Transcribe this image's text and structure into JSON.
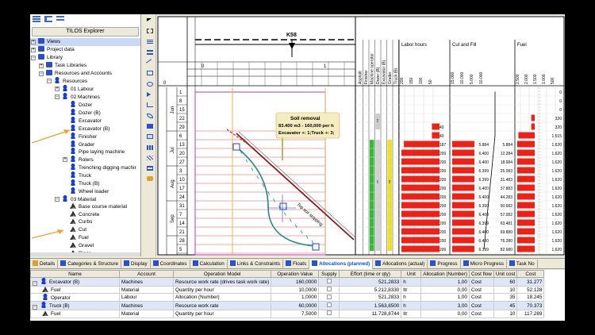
{
  "explorer": {
    "title": "TILOS Explorer",
    "items": [
      {
        "label": "Views",
        "icon": "folder-icon",
        "level": 0,
        "expander": "plus",
        "selected": true
      },
      {
        "label": "Project data",
        "icon": "folder-icon",
        "level": 0,
        "expander": "plus"
      },
      {
        "label": "Library",
        "icon": "folder-icon",
        "level": 0,
        "expander": "minus"
      },
      {
        "label": "Task Libraries",
        "icon": "folder-icon",
        "level": 1,
        "expander": "plus"
      },
      {
        "label": "Resources and Accounts",
        "icon": "folder-icon",
        "level": 1,
        "expander": "minus"
      },
      {
        "label": "Resources",
        "icon": "resource-icon",
        "level": 2,
        "expander": "minus"
      },
      {
        "label": "01 Labour",
        "icon": "resource-icon",
        "level": 3,
        "expander": "plus"
      },
      {
        "label": "02 Machines",
        "icon": "resource-icon",
        "level": 3,
        "expander": "minus"
      },
      {
        "label": "Dozer",
        "icon": "resource-icon",
        "level": 4
      },
      {
        "label": "Dozer (B)",
        "icon": "resource-icon",
        "level": 4
      },
      {
        "label": "Excavator",
        "icon": "resource-icon",
        "level": 4
      },
      {
        "label": "Excavator (B)",
        "icon": "resource-icon",
        "level": 4
      },
      {
        "label": "Finisher",
        "icon": "resource-icon",
        "level": 4
      },
      {
        "label": "Grader",
        "icon": "resource-icon",
        "level": 4
      },
      {
        "label": "Pipe laying machine",
        "icon": "resource-icon",
        "level": 4
      },
      {
        "label": "Rolers",
        "icon": "resource-icon",
        "level": 4,
        "expander": "plus"
      },
      {
        "label": "Trenching digging machir",
        "icon": "resource-icon",
        "level": 4
      },
      {
        "label": "Truck",
        "icon": "resource-icon",
        "level": 4
      },
      {
        "label": "Truck (B)",
        "icon": "resource-icon",
        "level": 4
      },
      {
        "label": "Wheel loader",
        "icon": "resource-icon",
        "level": 4
      },
      {
        "label": "03 Material",
        "icon": "resource-icon",
        "level": 3,
        "expander": "minus"
      },
      {
        "label": "Base course material",
        "icon": "material-icon",
        "level": 4
      },
      {
        "label": "Concrete",
        "icon": "material-icon",
        "level": 4
      },
      {
        "label": "Curbs",
        "icon": "material-icon",
        "level": 4
      },
      {
        "label": "Cut",
        "icon": "material-icon",
        "level": 4
      },
      {
        "label": "Fuel",
        "icon": "material-icon",
        "level": 4
      },
      {
        "label": "Gravel",
        "icon": "material-icon",
        "level": 4
      },
      {
        "label": "Piece",
        "icon": "material-icon",
        "level": 4
      }
    ]
  },
  "tools": [
    "pointer-icon",
    "select-icon",
    "rows-icon",
    "list-icon",
    "line-icon",
    "rect-icon",
    "circle-icon",
    "arrow-icon",
    "pen-icon",
    "curve-icon",
    "text-icon",
    "frame-icon",
    "bar-icon",
    "hatch-icon",
    "table-icon",
    "brush-icon"
  ],
  "chart": {
    "station_label": "K58",
    "axis_top_value": "0",
    "station_ticks": [
      "0",
      "1"
    ],
    "callout": {
      "title": "Soil removal",
      "line1": "83.400 m3 - 160,000 per h",
      "line2": "Excavator +: 1;Truck +: 3;"
    },
    "task_label": "Top soil stripping",
    "week_labels": [
      "1",
      "8",
      "15",
      "22",
      "29",
      "6",
      "13",
      "20",
      "27",
      "3",
      "10",
      "17",
      "24",
      "31",
      "7",
      "14",
      "21",
      "28",
      "5"
    ],
    "months": [
      "Jun",
      "Jul",
      "Aug",
      "Sep"
    ],
    "vert_headers": [
      "Asphalt",
      "Finisher",
      "Machine operator",
      "Dozer (B)",
      "Excavator (B)",
      "Grader",
      "Truck (B)"
    ],
    "vert_counts": [
      "1",
      "1",
      "3"
    ],
    "section_titles": {
      "labor": "Labor hours",
      "cut": "Cut and Fill",
      "fuel": "Fuel"
    },
    "labor_ticks": [
      "200",
      "150",
      "100",
      "50"
    ],
    "cut_ticks": [
      "15.000",
      "10.000",
      "5.000",
      "10.000"
    ],
    "fuel_ticks": [
      "2.500",
      "2.000",
      "1.500",
      "1.000",
      "500"
    ],
    "labor_values": [
      "",
      "",
      "",
      "",
      "40",
      "40",
      "187",
      "200",
      "200",
      "200",
      "200",
      "200",
      "200",
      "200",
      "200",
      "200",
      "200",
      "200",
      "200"
    ],
    "labor_hours": [
      0,
      0,
      0,
      0,
      40,
      40,
      187,
      200,
      200,
      200,
      200,
      200,
      200,
      200,
      200,
      200,
      200,
      200,
      200
    ],
    "cut_vals1": [
      "",
      "",
      "",
      "",
      "",
      "",
      "5.884",
      "6.400",
      "6.400",
      "6.399",
      "6.399",
      "6.400",
      "6.400",
      "6.399",
      "6.400",
      "6.399",
      "6.400",
      "6.400",
      "6.399"
    ],
    "cut_vals2": [
      "",
      "",
      "",
      "",
      "",
      "",
      "5.884",
      "12.284",
      "18.684",
      "25.083",
      "31.483",
      "37.883",
      "44.283",
      "50.682",
      "57.082",
      "63.481",
      "69.880",
      "76.280",
      "82.680"
    ],
    "cut_cumulative": [
      0,
      0,
      0,
      0,
      0,
      0,
      5884,
      12284,
      18684,
      25083,
      31483,
      37883,
      44283,
      50682,
      57082,
      63481,
      69880,
      76280,
      82680
    ],
    "fuel_values": [
      "0",
      "0",
      "0",
      "320",
      "320",
      "1.515",
      "1.620",
      "1.620",
      "1.620",
      "1.620",
      "1.620",
      "1.620",
      "1.620",
      "1.620",
      "1.620",
      "1.620",
      "1.620",
      "1.620",
      "1.620"
    ],
    "fuel_amounts": [
      0,
      0,
      0,
      320,
      320,
      1515,
      1620,
      1620,
      1620,
      1620,
      1620,
      1620,
      1620,
      1620,
      1620,
      1620,
      1620,
      1620,
      1620
    ]
  },
  "tabs": [
    {
      "label": "Details"
    },
    {
      "label": "Categories & Structure"
    },
    {
      "label": "Display"
    },
    {
      "label": "Coordinates"
    },
    {
      "label": "Calculation"
    },
    {
      "label": "Links & Constraints"
    },
    {
      "label": "Floats"
    },
    {
      "label": "Allocations (planned)",
      "active": true
    },
    {
      "label": "Allocations (actual)"
    },
    {
      "label": "Progress"
    },
    {
      "label": "Micro Progress"
    },
    {
      "label": "Task No"
    }
  ],
  "grid": {
    "columns": [
      "Name",
      "Account",
      "Operation Model",
      "Operation Value",
      "Supply",
      "Effort (time or qty)",
      "Unit",
      "Allocation (Number)",
      "Cost flow",
      "Unit cost",
      "Cost"
    ],
    "rows": [
      {
        "name": "Excavator (B)",
        "account": "Machines",
        "model": "Resource work rate (drives task work rate)",
        "value": "160,0000",
        "effort": "521,2833",
        "unit": "h",
        "alloc": "1,00",
        "flow": "Cost",
        "ucost": "60",
        "cost": "31.277",
        "group": true,
        "icon": "resource-icon"
      },
      {
        "name": "Fuel",
        "account": "Material",
        "model": "Quantity per hour",
        "value": "10,0000",
        "effort": "5.212,8330",
        "unit": "ltr",
        "alloc": "0,00",
        "flow": "Cost",
        "ucost": "10",
        "cost": "52.128",
        "group": false,
        "icon": "material-icon"
      },
      {
        "name": "Operator",
        "account": "Labour",
        "model": "Allocation (Number)",
        "value": "1,0000",
        "effort": "521,2833",
        "unit": "h",
        "alloc": "1,00",
        "flow": "Cost",
        "ucost": "35",
        "cost": "18.245",
        "group": false,
        "icon": "resource-icon"
      },
      {
        "name": "Truck (B)",
        "account": "Machines",
        "model": "Resource work rate",
        "value": "60,0000",
        "effort": "1.563,8500",
        "unit": "h",
        "alloc": "3,00",
        "flow": "Cost",
        "ucost": "45",
        "cost": "70.373",
        "group": true,
        "icon": "resource-icon"
      },
      {
        "name": "Fuel",
        "account": "Material",
        "model": "Quantity per hour",
        "value": "7,5000",
        "effort": "11.728,8744",
        "unit": "ltr",
        "alloc": "0,00",
        "flow": "Cost",
        "ucost": "10",
        "cost": "117.289",
        "group": false,
        "icon": "material-icon"
      }
    ]
  },
  "colors": {
    "accent": "#1050c8",
    "red_bar": "#e8231a",
    "task_line": "#8a1a1a",
    "curve": "#1e8a8a",
    "arrow": "#f0a030",
    "green": "#33bb33",
    "yellow": "#f0e020"
  }
}
